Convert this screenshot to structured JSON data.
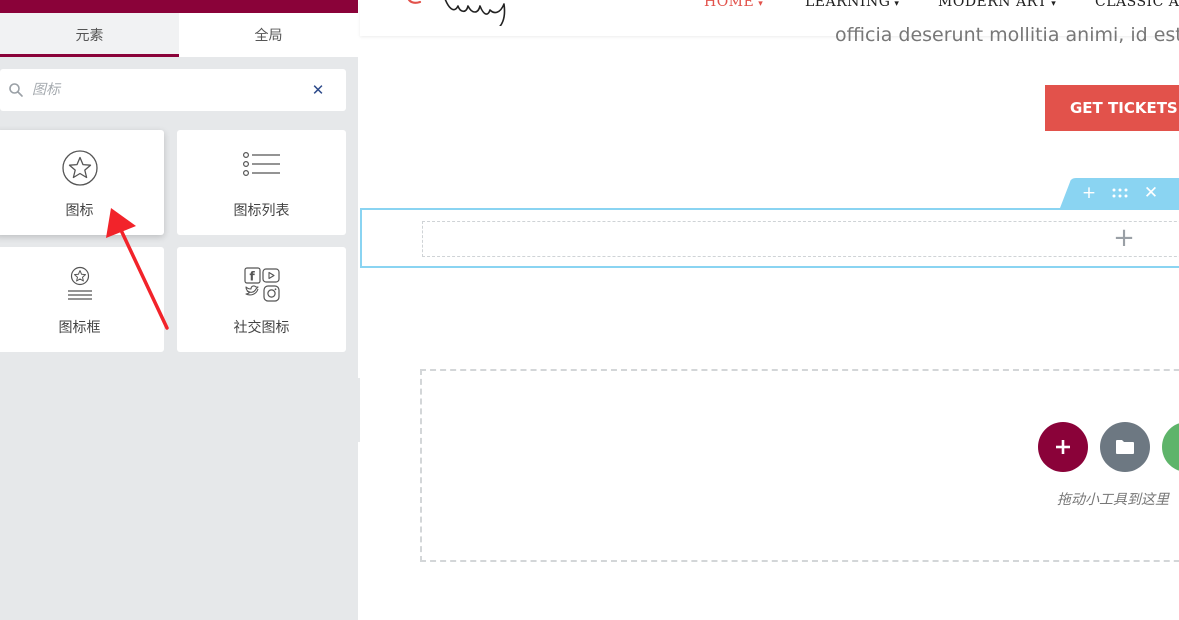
{
  "panel": {
    "tabs": [
      {
        "label": "元素"
      },
      {
        "label": "全局"
      }
    ],
    "search": {
      "placeholder": "图标",
      "clear_label": "✕"
    },
    "widgets": [
      {
        "label": "图标",
        "icon": "star-circle-icon"
      },
      {
        "label": "图标列表",
        "icon": "list-icon"
      },
      {
        "label": "图标框",
        "icon": "icon-box-icon"
      },
      {
        "label": "社交图标",
        "icon": "social-icons-icon"
      }
    ]
  },
  "preview": {
    "nav": [
      {
        "label": "HOME",
        "active": true
      },
      {
        "label": "LEARNING"
      },
      {
        "label": "MODERN ART"
      },
      {
        "label": "CLASSIC ART"
      }
    ],
    "hero_text": "officia deserunt mollitia animi, id est la",
    "tickets_button": "GET TICKETS",
    "section_handle": {
      "add": "+",
      "close": "✕"
    },
    "column_add": "+",
    "dropzone_text": "拖动小工具到这里"
  },
  "colors": {
    "brand": "#8a0239",
    "accent_red": "#e2524b",
    "section_blue": "#8ad4f2",
    "template_gray": "#6d7882",
    "kit_green": "#5eb46a"
  }
}
